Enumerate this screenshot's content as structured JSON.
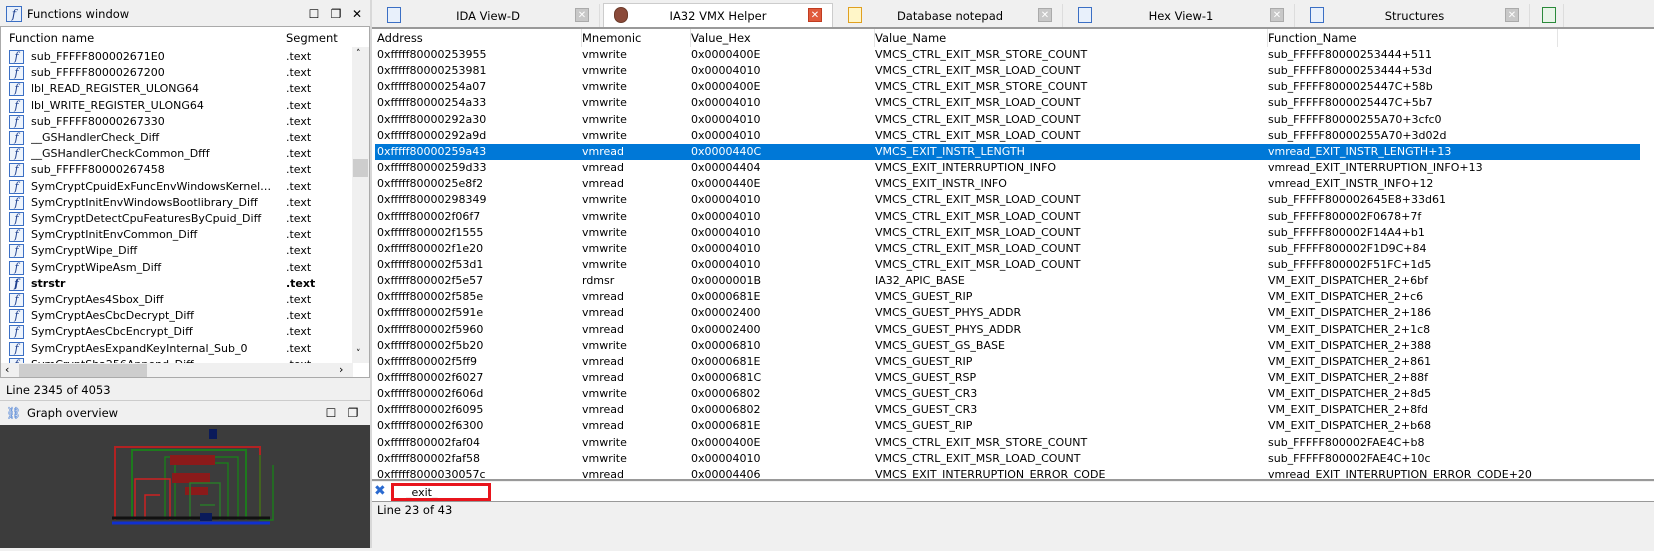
{
  "functions_window": {
    "title": "Functions window",
    "columns": [
      "Function name",
      "Segment"
    ],
    "items": [
      {
        "name": "sub_FFFFF800002671E0",
        "segment": ".text"
      },
      {
        "name": "sub_FFFFF80000267200",
        "segment": ".text"
      },
      {
        "name": "lbl_READ_REGISTER_ULONG64",
        "segment": ".text"
      },
      {
        "name": "lbl_WRITE_REGISTER_ULONG64",
        "segment": ".text"
      },
      {
        "name": "sub_FFFFF80000267330",
        "segment": ".text"
      },
      {
        "name": "__GSHandlerCheck_Diff",
        "segment": ".text"
      },
      {
        "name": "__GSHandlerCheckCommon_Dfff",
        "segment": ".text"
      },
      {
        "name": "sub_FFFFF80000267458",
        "segment": ".text"
      },
      {
        "name": "SymCryptCpuidExFuncEnvWindowsKernelmode...",
        "segment": ".text"
      },
      {
        "name": "SymCryptInitEnvWindowsBootlibrary_Diff",
        "segment": ".text"
      },
      {
        "name": "SymCryptDetectCpuFeaturesByCpuid_Diff",
        "segment": ".text"
      },
      {
        "name": "SymCryptInitEnvCommon_Diff",
        "segment": ".text"
      },
      {
        "name": "SymCryptWipe_Diff",
        "segment": ".text"
      },
      {
        "name": "SymCryptWipeAsm_Diff",
        "segment": ".text"
      },
      {
        "name": "strstr",
        "segment": ".text",
        "bold": true
      },
      {
        "name": "SymCryptAes4Sbox_Diff",
        "segment": ".text"
      },
      {
        "name": "SymCryptAesCbcDecrypt_Diff",
        "segment": ".text"
      },
      {
        "name": "SymCryptAesCbcEncrypt_Diff",
        "segment": ".text"
      },
      {
        "name": "SymCryptAesExpandKeyInternal_Sub_0",
        "segment": ".text"
      },
      {
        "name": "SymCryptSha256Append_Diff",
        "segment": ".text"
      }
    ],
    "status": "Line 2345 of 4053"
  },
  "graph_overview": {
    "title": "Graph overview"
  },
  "tabs": [
    {
      "label": "IDA View-D",
      "active": false
    },
    {
      "label": "IA32 VMX Helper",
      "active": true
    },
    {
      "label": "Database notepad",
      "active": false
    },
    {
      "label": "Hex View-1",
      "active": false
    },
    {
      "label": "Structures",
      "active": false
    }
  ],
  "table": {
    "columns": [
      "Address",
      "Mnemonic",
      "Value_Hex",
      "Value_Name",
      "Function_Name"
    ],
    "selected_index": 6,
    "rows": [
      [
        "0xfffff80000253955",
        "vmwrite",
        "0x0000400E",
        "VMCS_CTRL_EXIT_MSR_STORE_COUNT",
        "sub_FFFFF80000253444+511"
      ],
      [
        "0xfffff80000253981",
        "vmwrite",
        "0x00004010",
        "VMCS_CTRL_EXIT_MSR_LOAD_COUNT",
        "sub_FFFFF80000253444+53d"
      ],
      [
        "0xfffff80000254a07",
        "vmwrite",
        "0x0000400E",
        "VMCS_CTRL_EXIT_MSR_STORE_COUNT",
        "sub_FFFFF8000025447C+58b"
      ],
      [
        "0xfffff80000254a33",
        "vmwrite",
        "0x00004010",
        "VMCS_CTRL_EXIT_MSR_LOAD_COUNT",
        "sub_FFFFF8000025447C+5b7"
      ],
      [
        "0xfffff80000292a30",
        "vmwrite",
        "0x00004010",
        "VMCS_CTRL_EXIT_MSR_LOAD_COUNT",
        "sub_FFFFF80000255A70+3cfc0"
      ],
      [
        "0xfffff80000292a9d",
        "vmwrite",
        "0x00004010",
        "VMCS_CTRL_EXIT_MSR_LOAD_COUNT",
        "sub_FFFFF80000255A70+3d02d"
      ],
      [
        "0xfffff80000259a43",
        "vmread",
        "0x0000440C",
        "VMCS_EXIT_INSTR_LENGTH",
        "vmread_EXIT_INSTR_LENGTH+13"
      ],
      [
        "0xfffff80000259d33",
        "vmread",
        "0x00004404",
        "VMCS_EXIT_INTERRUPTION_INFO",
        "vmread_EXIT_INTERRUPTION_INFO+13"
      ],
      [
        "0xfffff8000025e8f2",
        "vmread",
        "0x0000440E",
        "VMCS_EXIT_INSTR_INFO",
        "vmread_EXIT_INSTR_INFO+12"
      ],
      [
        "0xfffff80000298349",
        "vmwrite",
        "0x00004010",
        "VMCS_CTRL_EXIT_MSR_LOAD_COUNT",
        "sub_FFFFF800002645E8+33d61"
      ],
      [
        "0xfffff800002f06f7",
        "vmwrite",
        "0x00004010",
        "VMCS_CTRL_EXIT_MSR_LOAD_COUNT",
        "sub_FFFFF800002F0678+7f"
      ],
      [
        "0xfffff800002f1555",
        "vmwrite",
        "0x00004010",
        "VMCS_CTRL_EXIT_MSR_LOAD_COUNT",
        "sub_FFFFF800002F14A4+b1"
      ],
      [
        "0xfffff800002f1e20",
        "vmwrite",
        "0x00004010",
        "VMCS_CTRL_EXIT_MSR_LOAD_COUNT",
        "sub_FFFFF800002F1D9C+84"
      ],
      [
        "0xfffff800002f53d1",
        "vmwrite",
        "0x00004010",
        "VMCS_CTRL_EXIT_MSR_LOAD_COUNT",
        "sub_FFFFF800002F51FC+1d5"
      ],
      [
        "0xfffff800002f5e57",
        "rdmsr",
        "0x0000001B",
        "IA32_APIC_BASE",
        "VM_EXIT_DISPATCHER_2+6bf"
      ],
      [
        "0xfffff800002f585e",
        "vmread",
        "0x0000681E",
        "VMCS_GUEST_RIP",
        "VM_EXIT_DISPATCHER_2+c6"
      ],
      [
        "0xfffff800002f591e",
        "vmread",
        "0x00002400",
        "VMCS_GUEST_PHYS_ADDR",
        "VM_EXIT_DISPATCHER_2+186"
      ],
      [
        "0xfffff800002f5960",
        "vmread",
        "0x00002400",
        "VMCS_GUEST_PHYS_ADDR",
        "VM_EXIT_DISPATCHER_2+1c8"
      ],
      [
        "0xfffff800002f5b20",
        "vmwrite",
        "0x00006810",
        "VMCS_GUEST_GS_BASE",
        "VM_EXIT_DISPATCHER_2+388"
      ],
      [
        "0xfffff800002f5ff9",
        "vmread",
        "0x0000681E",
        "VMCS_GUEST_RIP",
        "VM_EXIT_DISPATCHER_2+861"
      ],
      [
        "0xfffff800002f6027",
        "vmread",
        "0x0000681C",
        "VMCS_GUEST_RSP",
        "VM_EXIT_DISPATCHER_2+88f"
      ],
      [
        "0xfffff800002f606d",
        "vmwrite",
        "0x00006802",
        "VMCS_GUEST_CR3",
        "VM_EXIT_DISPATCHER_2+8d5"
      ],
      [
        "0xfffff800002f6095",
        "vmread",
        "0x00006802",
        "VMCS_GUEST_CR3",
        "VM_EXIT_DISPATCHER_2+8fd"
      ],
      [
        "0xfffff800002f6300",
        "vmread",
        "0x0000681E",
        "VMCS_GUEST_RIP",
        "VM_EXIT_DISPATCHER_2+b68"
      ],
      [
        "0xfffff800002faf04",
        "vmwrite",
        "0x0000400E",
        "VMCS_CTRL_EXIT_MSR_STORE_COUNT",
        "sub_FFFFF800002FAE4C+b8"
      ],
      [
        "0xfffff800002faf58",
        "vmwrite",
        "0x00004010",
        "VMCS_CTRL_EXIT_MSR_LOAD_COUNT",
        "sub_FFFFF800002FAE4C+10c"
      ],
      [
        "0xfffff8000030057c",
        "vmread",
        "0x00004406",
        "VMCS_EXIT_INTERRUPTION_ERROR_CODE",
        "vmread_EXIT_INTERRUPTION_ERROR_CODE+20"
      ]
    ]
  },
  "search": {
    "value": "_exit_"
  },
  "status": "Line 23 of 43",
  "colors": {
    "selection": "#0078d7",
    "search_highlight": "#e8141c",
    "graph_bg": "#3c3c3c"
  }
}
